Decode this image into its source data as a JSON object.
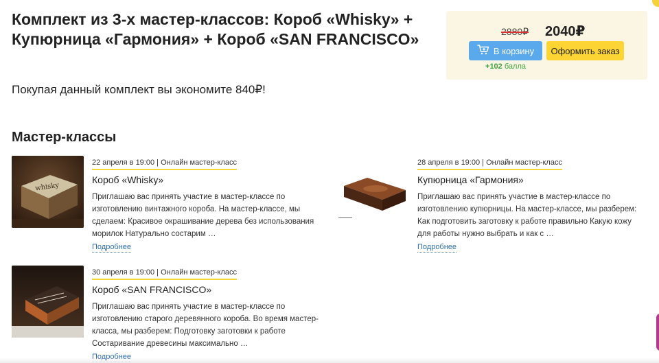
{
  "product": {
    "title": "Комплект из 3-х мастер-классов: Короб «Whisky» + Купюрница «Гармония» + Короб «SAN FRANCISCO»",
    "savings_text": "Покупая данный комплект вы экономите 840₽!"
  },
  "buy_box": {
    "old_price": "2880₽",
    "new_price": "2040₽",
    "cart_label": "В корзину",
    "order_label": "Оформить заказ",
    "bonus_amount": "+102",
    "bonus_unit": "балла"
  },
  "section_title": "Мастер-классы",
  "master_classes": [
    {
      "meta": "22 апреля в 19:00 | Онлайн мастер-класс",
      "title": "Короб «Whisky»",
      "description": "Приглашаю вас принять участие в мастер-классе по изготовлению винтажного короба. На мастер-классе, мы сделаем: Красивое окрашивание дерева без использования морилок Натурально состарим …",
      "more": "Подробнее",
      "image": "whisky-box-photo"
    },
    {
      "meta": "28 апреля в 19:00 | Онлайн мастер-класс",
      "title": "Купюрница «Гармония»",
      "description": "Приглашаю вас принять участие в мастер-классе по изготовлению купюрницы. На мастер-классе, мы разберем: Как подготовить заготовку к работе правильно Какую кожу для работы нужно выбрать и как с …",
      "more": "Подробнее",
      "image": "bill-holder-photo"
    },
    {
      "meta": "30 апреля в 19:00 | Онлайн мастер-класс",
      "title": "Короб «SAN FRANCISCO»",
      "description": "Приглашаю вас принять участие в мастер-классе по изготовлению старого деревянного короба. Во время мастер-класса, мы разберем: Подготовку заготовки к работе Состаривание древесины максимально …",
      "more": "Подробнее",
      "image": "san-francisco-box-photo"
    }
  ],
  "colors": {
    "accent_yellow": "#fcd535",
    "cart_blue": "#5aa9ec",
    "bonus_green": "#3da33d",
    "buy_box_bg": "#faf6e3",
    "link_blue": "#2f6fb5"
  }
}
